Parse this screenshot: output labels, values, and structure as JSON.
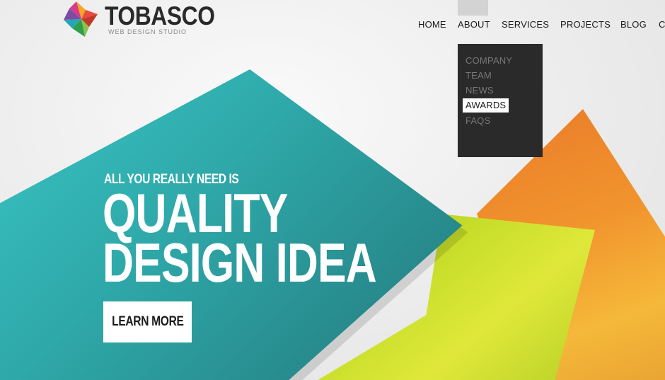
{
  "brand": {
    "name": "TOBASCO",
    "tagline": "WEB DESIGN STUDIO",
    "icon": "pinwheel-star-logo"
  },
  "nav": {
    "items": [
      {
        "label": "HOME"
      },
      {
        "label": "ABOUT"
      },
      {
        "label": "SERVICES"
      },
      {
        "label": "PROJECTS"
      },
      {
        "label": "BLOG"
      },
      {
        "label": "C"
      }
    ],
    "hovered": "ABOUT"
  },
  "dropdown": {
    "items": [
      {
        "label": "COMPANY"
      },
      {
        "label": "TEAM"
      },
      {
        "label": "NEWS"
      },
      {
        "label": "AWARDS",
        "active": true
      },
      {
        "label": "FAQS"
      }
    ]
  },
  "hero": {
    "kicker": "ALL YOU REALLY NEED IS",
    "headline_line1": "QUALITY",
    "headline_line2": "DESIGN IDEA",
    "cta_label": "LEARN MORE"
  },
  "colors": {
    "teal": "#2fa9aa",
    "green": "#c7dd2a",
    "orange": "#f1942d",
    "dropdown_bg": "#2a2a2a",
    "text_dark": "#2a2a2a"
  }
}
